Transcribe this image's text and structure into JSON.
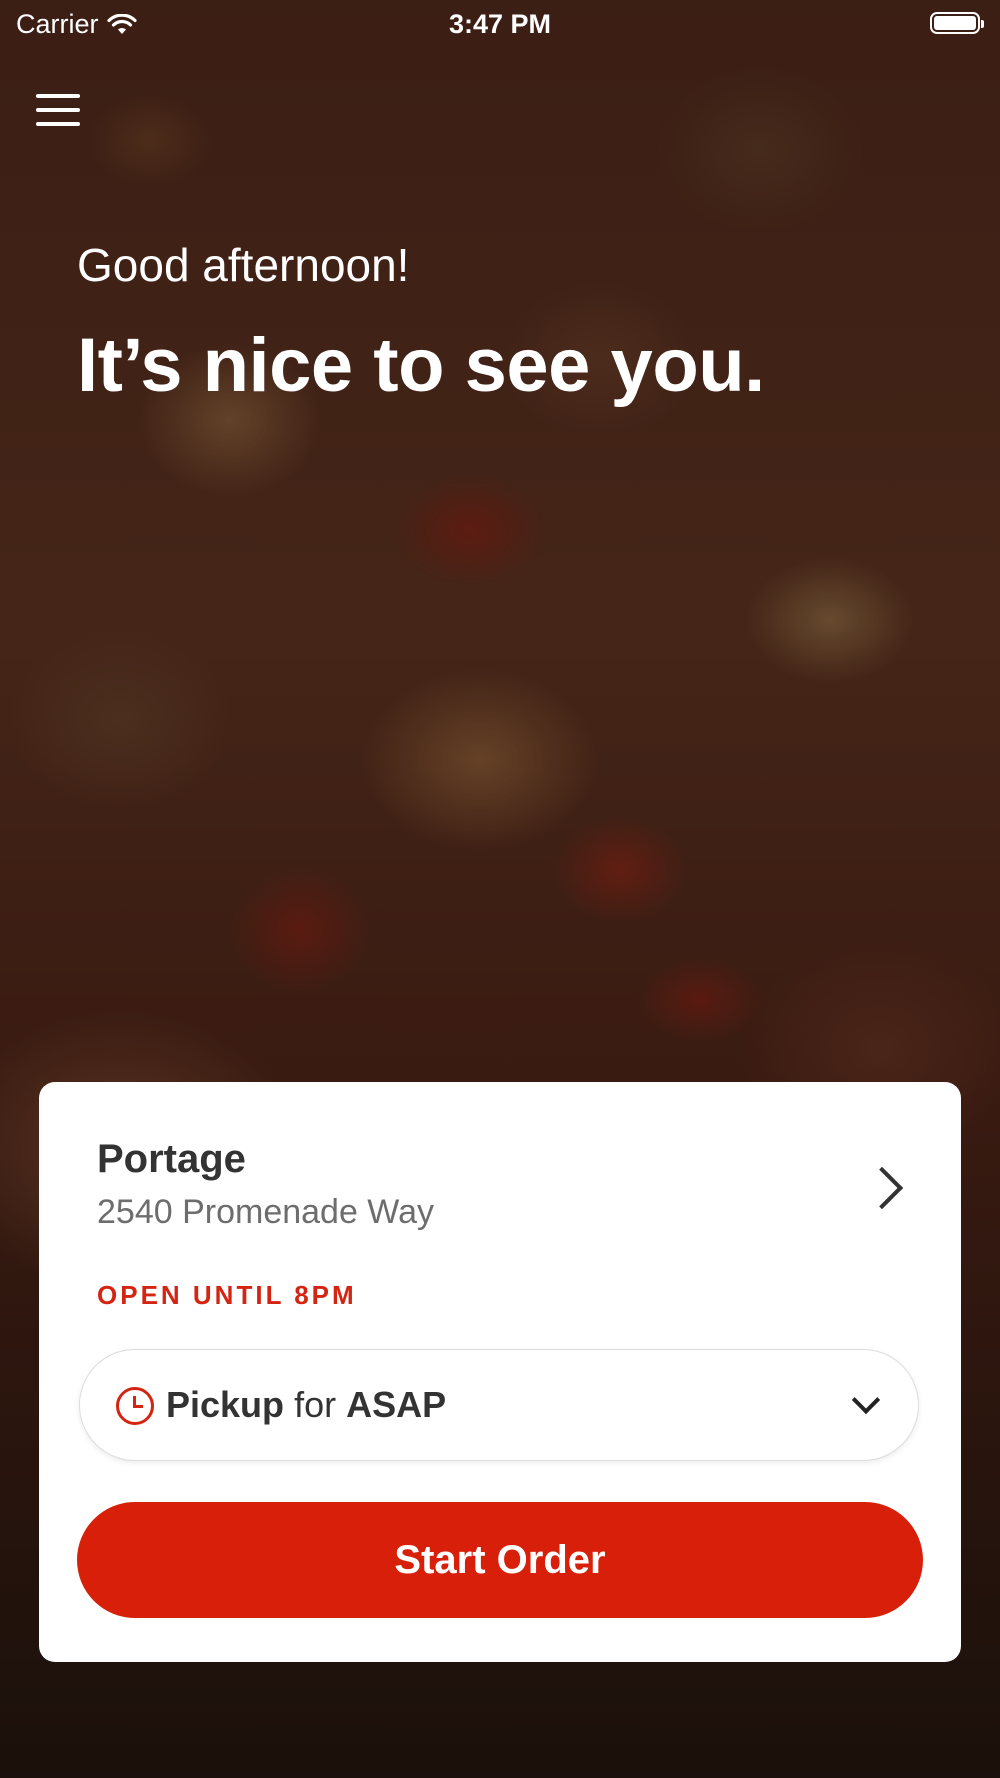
{
  "status_bar": {
    "carrier": "Carrier",
    "time": "3:47 PM",
    "wifi_icon": "wifi-icon",
    "battery_icon": "battery-icon"
  },
  "header": {
    "menu_icon": "hamburger-menu-icon",
    "greeting": "Good afternoon!",
    "headline": "It’s nice to see you."
  },
  "location": {
    "name": "Portage",
    "address": "2540 Promenade Way",
    "hours": "OPEN UNTIL 8PM"
  },
  "order_mode": {
    "mode": "Pickup",
    "connector": "for",
    "time": "ASAP",
    "icon": "clock-icon"
  },
  "cta": {
    "label": "Start Order"
  },
  "colors": {
    "accent": "#d71f0a",
    "text_dark": "#333333",
    "text_muted": "#6d6d6d"
  }
}
